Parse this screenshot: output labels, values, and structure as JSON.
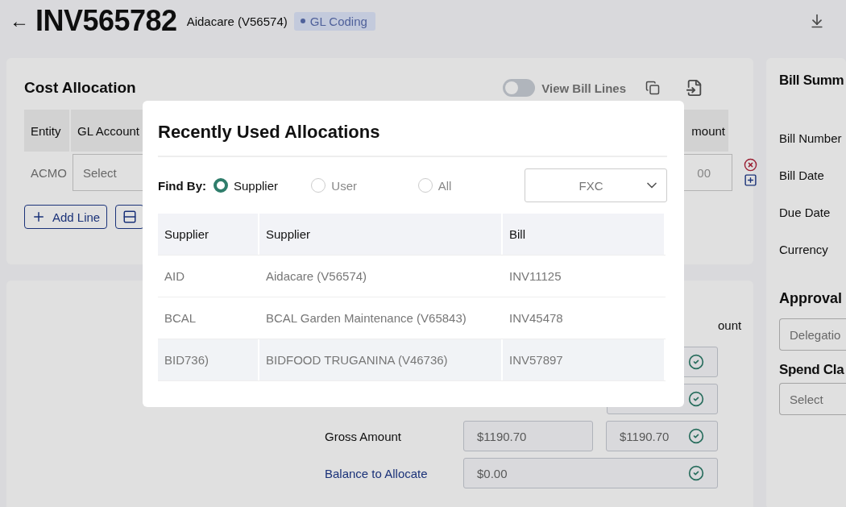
{
  "header": {
    "back": "←",
    "title": "INV565782",
    "supplier": "Aidacare (V56574)",
    "status": "GL Coding"
  },
  "cost_allocation": {
    "title": "Cost Allocation",
    "toggle": {
      "label": "View Bill Lines",
      "on": false
    },
    "columns": [
      "Entity",
      "GL Account",
      "mount"
    ],
    "row": {
      "entity": "ACMO",
      "gl_placeholder": "Select",
      "amount": "00"
    },
    "buttons": [
      "Add Line"
    ]
  },
  "totals": {
    "column": "ount",
    "rows": [
      {
        "kind": "partial",
        "label": "",
        "values": []
      },
      {
        "kind": "partial",
        "label": "",
        "values": []
      },
      {
        "kind": "pair",
        "label": "Gross Amount",
        "values": [
          "$1190.70",
          "$1190.70"
        ]
      },
      {
        "kind": "wide",
        "label": "Balance to Allocate",
        "values": [
          "$0.00"
        ]
      }
    ]
  },
  "summary": {
    "title": "Bill Summ",
    "labels": [
      "Bill Number",
      "Bill Date",
      "Due Date",
      "Currency"
    ],
    "approval": "Approval",
    "approval_placeholder": "Delegatio",
    "spend": "Spend Cla",
    "spend_placeholder": "Select"
  },
  "modal": {
    "title": "Recently Used Allocations",
    "find_by": "Find By:",
    "options": [
      {
        "label": "Supplier",
        "selected": true
      },
      {
        "label": "User",
        "selected": false
      },
      {
        "label": "All",
        "selected": false
      }
    ],
    "filter": "FXC",
    "columns": [
      "Supplier",
      "Supplier",
      "Bill"
    ],
    "rows": [
      {
        "code": "AID",
        "supplier": "Aidacare (V56574)",
        "bill": "INV11125",
        "highlighted": false
      },
      {
        "code": "BCAL",
        "supplier": "BCAL Garden Maintenance (V65843)",
        "bill": "INV45478",
        "highlighted": false
      },
      {
        "code": "BID736)",
        "supplier": "BIDFOOD TRUGANINA (V46736)",
        "bill": "INV57897",
        "highlighted": true
      }
    ]
  }
}
